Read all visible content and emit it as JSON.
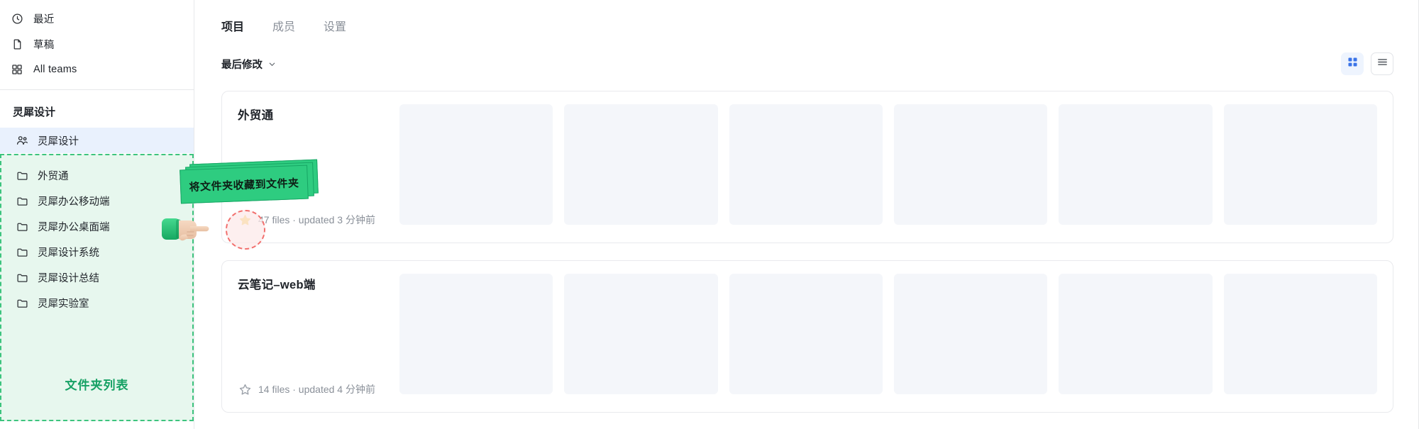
{
  "sidebar": {
    "nav": [
      {
        "label": "最近",
        "icon": "clock-icon"
      },
      {
        "label": "草稿",
        "icon": "file-icon"
      },
      {
        "label": "All teams",
        "icon": "grid-icon"
      }
    ],
    "team_heading": "灵犀设计",
    "team_active": {
      "label": "灵犀设计",
      "icon": "people-icon"
    },
    "folders": [
      {
        "label": "外贸通",
        "icon": "folder-icon"
      },
      {
        "label": "灵犀办公移动端",
        "icon": "folder-icon"
      },
      {
        "label": "灵犀办公桌面端",
        "icon": "folder-icon"
      },
      {
        "label": "灵犀设计系统",
        "icon": "folder-icon"
      },
      {
        "label": "灵犀设计总结",
        "icon": "folder-icon"
      },
      {
        "label": "灵犀实验室",
        "icon": "folder-icon"
      }
    ],
    "zone_caption": "文件夹列表"
  },
  "main": {
    "tabs": [
      {
        "label": "项目",
        "active": true
      },
      {
        "label": "成员",
        "active": false
      },
      {
        "label": "设置",
        "active": false
      }
    ],
    "sort": {
      "label": "最后修改",
      "icon": "chevron-down-icon"
    },
    "view": {
      "grid": {
        "icon": "grid-view-icon",
        "active": true
      },
      "list": {
        "icon": "list-view-icon",
        "active": false
      }
    },
    "cards": [
      {
        "title": "外贸通",
        "meta": "47 files · updated 3 分钟前",
        "starred": true,
        "thumbs": 6
      },
      {
        "title": "云笔记–web端",
        "meta": "14 files · updated 4 分钟前",
        "starred": false,
        "thumbs": 6
      }
    ]
  },
  "annotation": {
    "callout_text": "将文件夹收藏到文件夹",
    "callout_color": "#2ecc80",
    "highlight_color": "#f2706e",
    "zone_color": "#3dc47e",
    "hand_icon": "pointing-hand-icon"
  }
}
